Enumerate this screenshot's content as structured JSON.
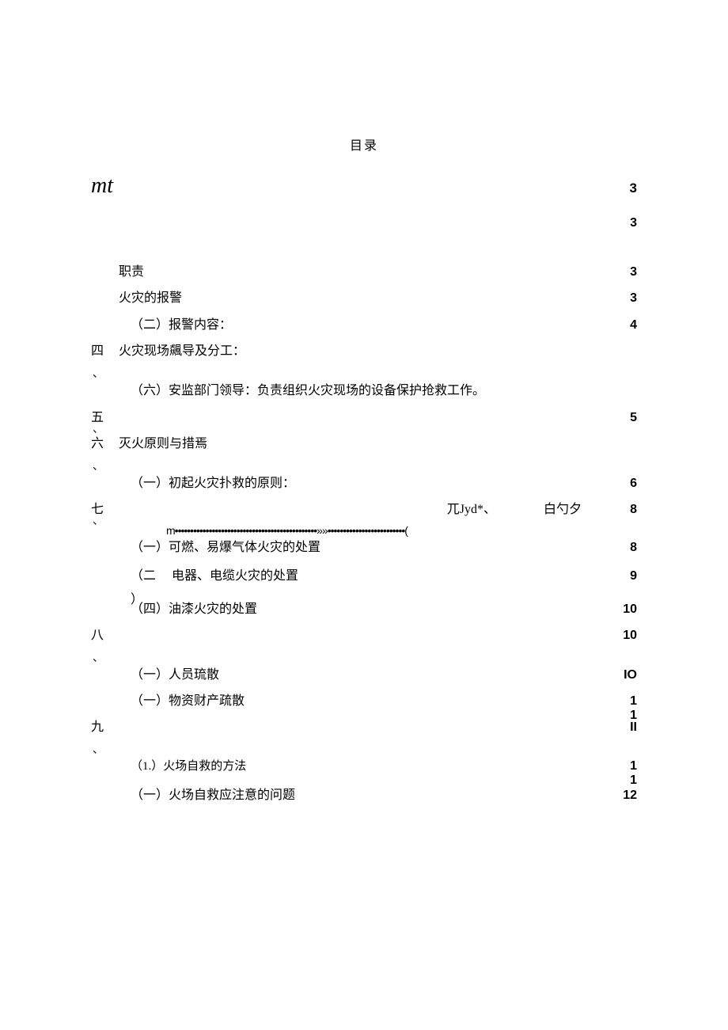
{
  "title": "目录",
  "heading_mt": "mt",
  "page_3a": "3",
  "page_3b": "3",
  "entry_zhize": "职责",
  "page_zhize": "3",
  "entry_baojing": "火灾的报警",
  "page_baojing": "3",
  "entry_baojing_content": "（二）报警内容：",
  "page_baojing_content": "4",
  "marker_4": "四",
  "marker_comma_4": "、",
  "entry_leadership": "火灾现场飆导及分工：",
  "entry_anjiandept": "（六）安监部门领导：负责组织火灾现场的设备保护抢救工作。",
  "marker_5": "五",
  "marker_comma_5": "、",
  "page_5": "5",
  "marker_6": "六",
  "marker_comma_6": "、",
  "entry_principle": "灭火原则与措焉",
  "entry_first_fire": "（一）初起火灾扑救的原则：",
  "page_first_fire": "6",
  "marker_7": "七",
  "marker_comma_7": "、",
  "entry_7_frag1": "兀Jyd*、",
  "entry_7_frag2": "白勺夕",
  "page_7": "8",
  "entry_dots_prefix": "m",
  "entry_dots": "••••••••••••••••••••••••••••••••••••••••••••••»»•••••••••••••••••••••••••(",
  "entry_combustible": "（一）可燃、易爆气体火灾的处置",
  "page_combustible": "8",
  "entry_electric_prefix": "（二",
  "entry_electric": "电器、电缆火灾的处置",
  "entry_electric_suffix": "）",
  "page_electric": "9",
  "entry_paint": "（四）油漆火灾的处置",
  "page_paint": "10",
  "marker_8": "八",
  "marker_comma_8": "、",
  "page_8": "10",
  "entry_evacuate_people": "（一）人员琉散",
  "page_evacuate_people": "IO",
  "entry_evacuate_assets": "（一）物资财产疏散",
  "page_evacuate_assets_1": "1",
  "page_evacuate_assets_2": "1",
  "marker_9": "九",
  "marker_comma_9": "、",
  "page_9": "II",
  "entry_selfrescue": "（1.）火场自救的方法",
  "page_selfrescue_1": "1",
  "page_selfrescue_2": "1",
  "entry_selfrescue_note": "（一）火场自救应注意的问题",
  "page_selfrescue_note": "12"
}
